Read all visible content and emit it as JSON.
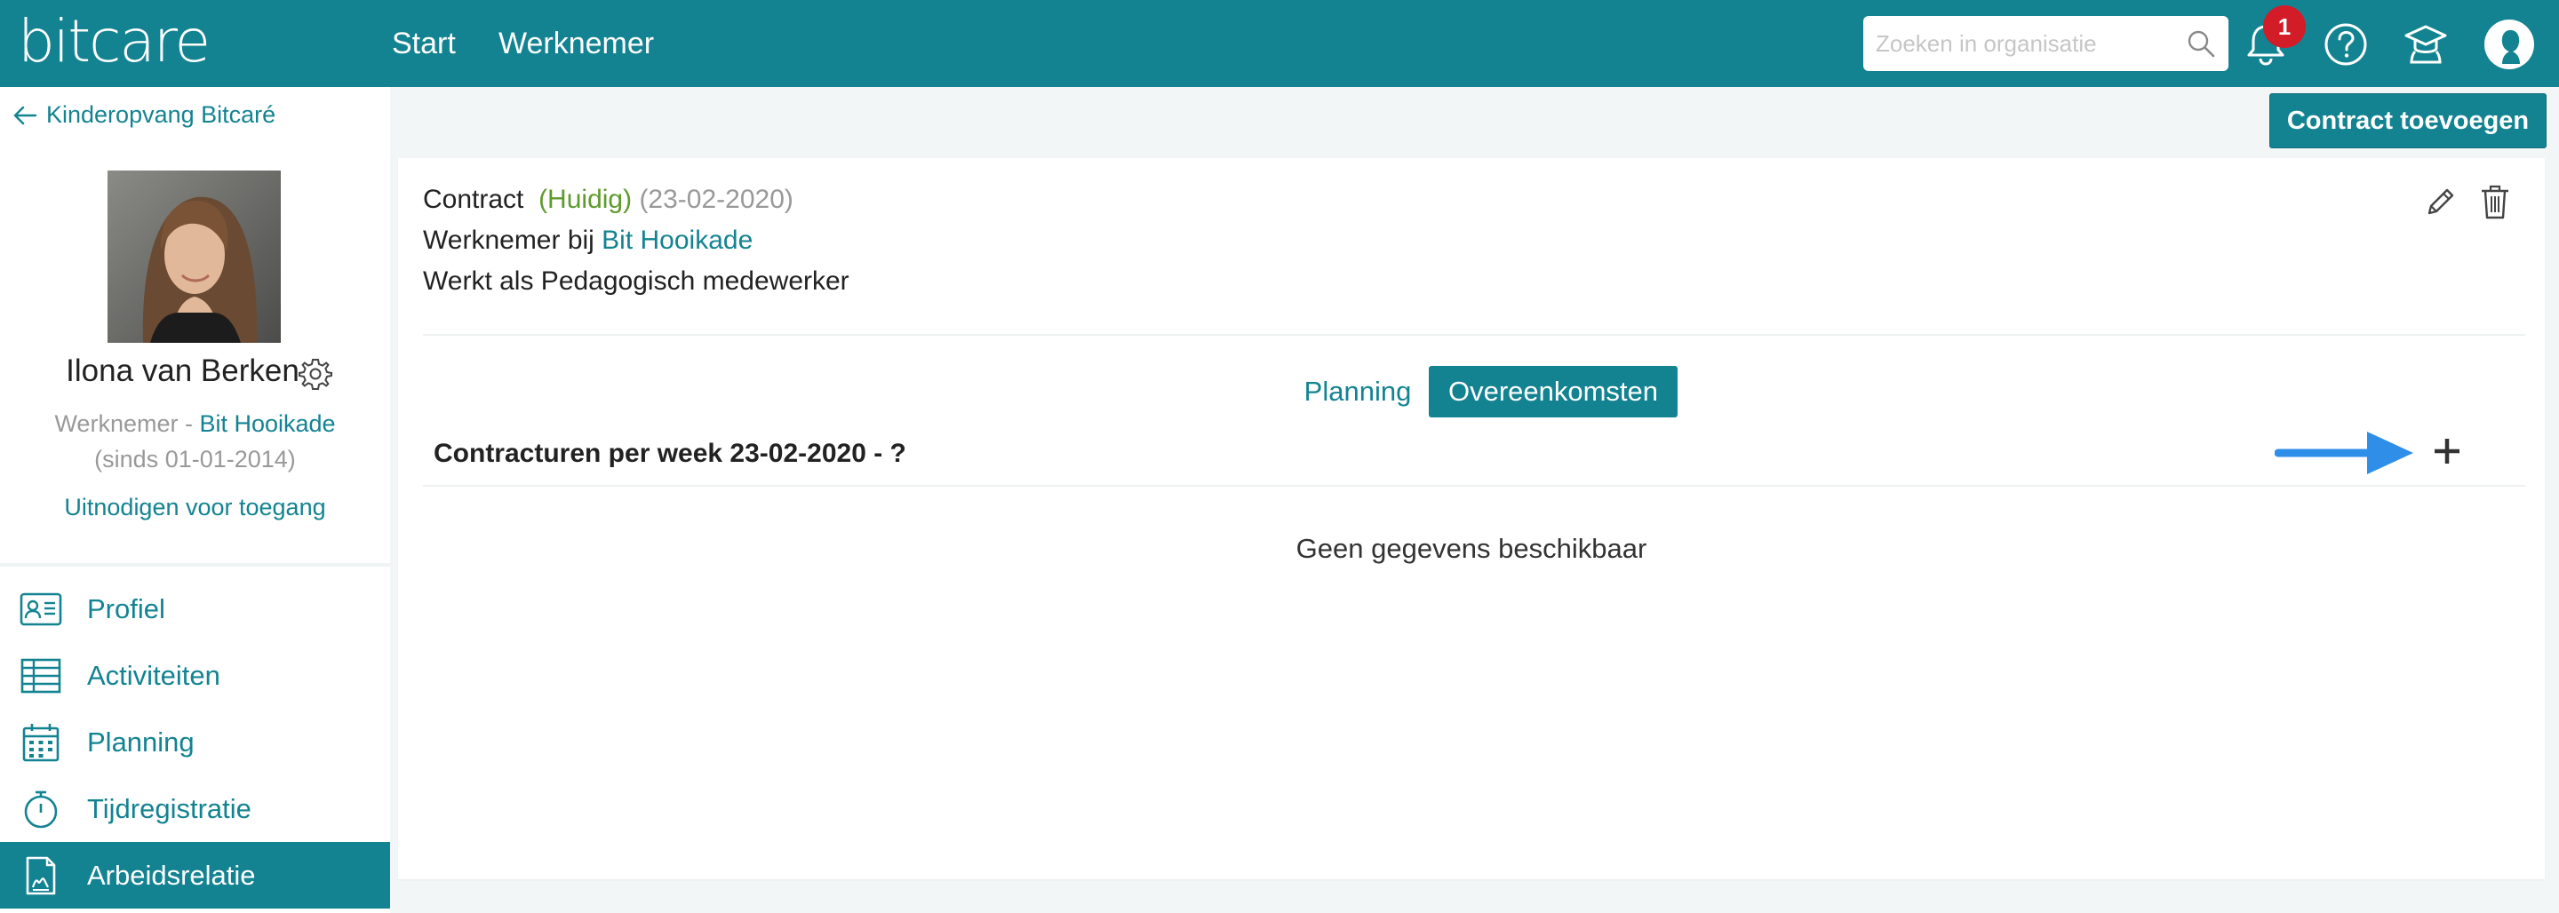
{
  "header": {
    "logo": "bitcare",
    "nav": [
      "Start",
      "Werknemer"
    ],
    "search_placeholder": "Zoeken in organisatie",
    "notification_count": "1"
  },
  "sidebar": {
    "back_label": "Kinderopvang Bitcaré",
    "person_name": "Ilona van Berken",
    "role_label": "Werknemer - ",
    "role_location": "Bit Hooikade",
    "since": "(sinds 01-01-2014)",
    "invite_label": "Uitnodigen voor toegang",
    "items": [
      {
        "label": "Profiel",
        "icon": "id-card-icon"
      },
      {
        "label": "Activiteiten",
        "icon": "table-icon"
      },
      {
        "label": "Planning",
        "icon": "calendar-icon"
      },
      {
        "label": "Tijdregistratie",
        "icon": "stopwatch-icon"
      },
      {
        "label": "Arbeidsrelatie",
        "icon": "document-icon",
        "active": true
      }
    ]
  },
  "main": {
    "add_contract_label": "Contract toevoegen",
    "contract": {
      "title": "Contract",
      "status": "(Huidig)",
      "date": "(23-02-2020)",
      "employer_prefix": "Werknemer bij ",
      "employer_link": "Bit Hooikade",
      "works_as": "Werkt als Pedagogisch medewerker"
    },
    "tabs": [
      "Planning",
      "Overeenkomsten"
    ],
    "hours_heading": "Contracturen per week 23-02-2020 - ?",
    "empty_message": "Geen gegevens beschikbaar"
  },
  "colors": {
    "brand": "#138392",
    "status_green": "#5f9a2c",
    "badge_red": "#d21c28",
    "annotation_arrow": "#2f8fe8"
  }
}
